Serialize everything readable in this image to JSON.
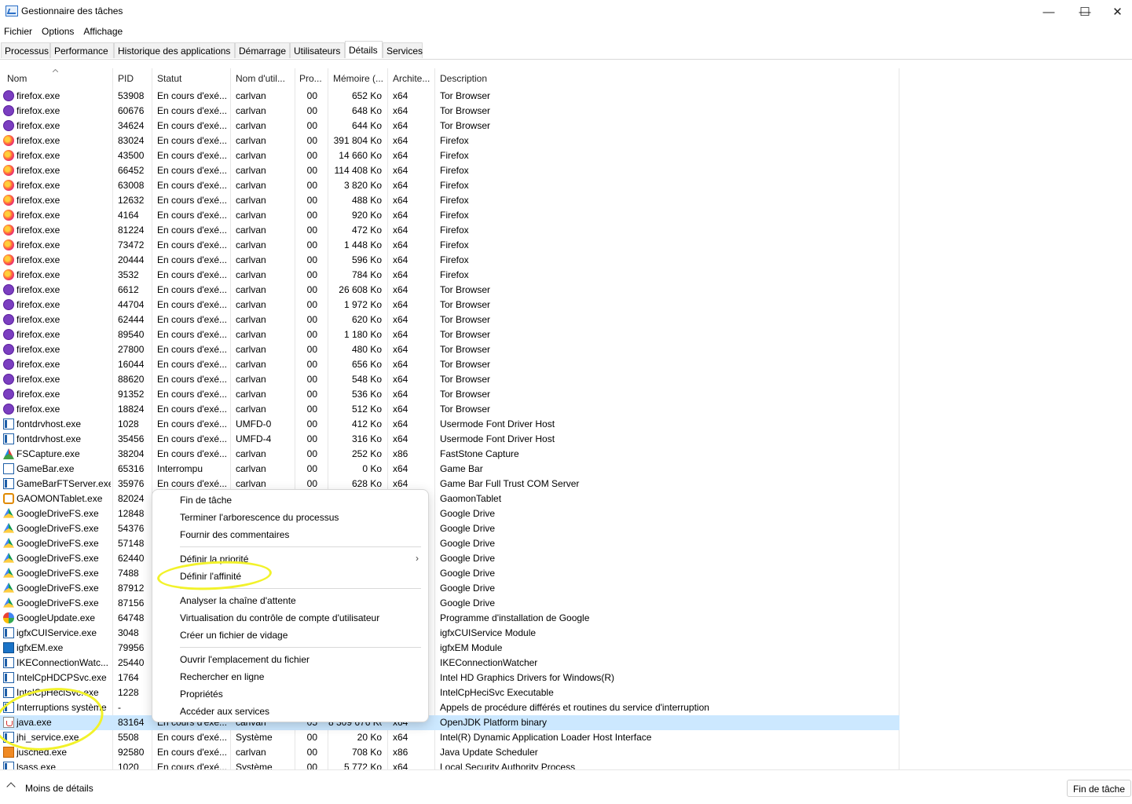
{
  "window": {
    "title": "Gestionnaire des tâches",
    "controls": [
      "—",
      "☐",
      "✕"
    ]
  },
  "menu": [
    "Fichier",
    "Options",
    "Affichage"
  ],
  "tabs": [
    "Processus",
    "Performance",
    "Historique des applications",
    "Démarrage",
    "Utilisateurs",
    "Détails",
    "Services"
  ],
  "active_tab": "Détails",
  "columns": [
    "Nom",
    "PID",
    "Statut",
    "Nom d'util...",
    "Pro...",
    "Mémoire (...",
    "Archite...",
    "Description"
  ],
  "rows": [
    {
      "icon": "tor-browser-icon",
      "name": "firefox.exe",
      "pid": "53908",
      "status": "En cours d'exé...",
      "user": "carlvan",
      "cpu": "00",
      "mem": "652 Ko",
      "arch": "x64",
      "desc": "Tor Browser"
    },
    {
      "icon": "tor-browser-icon",
      "name": "firefox.exe",
      "pid": "60676",
      "status": "En cours d'exé...",
      "user": "carlvan",
      "cpu": "00",
      "mem": "648 Ko",
      "arch": "x64",
      "desc": "Tor Browser"
    },
    {
      "icon": "tor-browser-icon",
      "name": "firefox.exe",
      "pid": "34624",
      "status": "En cours d'exé...",
      "user": "carlvan",
      "cpu": "00",
      "mem": "644 Ko",
      "arch": "x64",
      "desc": "Tor Browser"
    },
    {
      "icon": "firefox-icon",
      "name": "firefox.exe",
      "pid": "83024",
      "status": "En cours d'exé...",
      "user": "carlvan",
      "cpu": "00",
      "mem": "391 804 Ko",
      "arch": "x64",
      "desc": "Firefox"
    },
    {
      "icon": "firefox-icon",
      "name": "firefox.exe",
      "pid": "43500",
      "status": "En cours d'exé...",
      "user": "carlvan",
      "cpu": "00",
      "mem": "14 660 Ko",
      "arch": "x64",
      "desc": "Firefox"
    },
    {
      "icon": "firefox-icon",
      "name": "firefox.exe",
      "pid": "66452",
      "status": "En cours d'exé...",
      "user": "carlvan",
      "cpu": "00",
      "mem": "114 408 Ko",
      "arch": "x64",
      "desc": "Firefox"
    },
    {
      "icon": "firefox-icon",
      "name": "firefox.exe",
      "pid": "63008",
      "status": "En cours d'exé...",
      "user": "carlvan",
      "cpu": "00",
      "mem": "3 820 Ko",
      "arch": "x64",
      "desc": "Firefox"
    },
    {
      "icon": "firefox-icon",
      "name": "firefox.exe",
      "pid": "12632",
      "status": "En cours d'exé...",
      "user": "carlvan",
      "cpu": "00",
      "mem": "488 Ko",
      "arch": "x64",
      "desc": "Firefox"
    },
    {
      "icon": "firefox-icon",
      "name": "firefox.exe",
      "pid": "4164",
      "status": "En cours d'exé...",
      "user": "carlvan",
      "cpu": "00",
      "mem": "920 Ko",
      "arch": "x64",
      "desc": "Firefox"
    },
    {
      "icon": "firefox-icon",
      "name": "firefox.exe",
      "pid": "81224",
      "status": "En cours d'exé...",
      "user": "carlvan",
      "cpu": "00",
      "mem": "472 Ko",
      "arch": "x64",
      "desc": "Firefox"
    },
    {
      "icon": "firefox-icon",
      "name": "firefox.exe",
      "pid": "73472",
      "status": "En cours d'exé...",
      "user": "carlvan",
      "cpu": "00",
      "mem": "1 448 Ko",
      "arch": "x64",
      "desc": "Firefox"
    },
    {
      "icon": "firefox-icon",
      "name": "firefox.exe",
      "pid": "20444",
      "status": "En cours d'exé...",
      "user": "carlvan",
      "cpu": "00",
      "mem": "596 Ko",
      "arch": "x64",
      "desc": "Firefox"
    },
    {
      "icon": "firefox-icon",
      "name": "firefox.exe",
      "pid": "3532",
      "status": "En cours d'exé...",
      "user": "carlvan",
      "cpu": "00",
      "mem": "784 Ko",
      "arch": "x64",
      "desc": "Firefox"
    },
    {
      "icon": "tor-browser-icon",
      "name": "firefox.exe",
      "pid": "6612",
      "status": "En cours d'exé...",
      "user": "carlvan",
      "cpu": "00",
      "mem": "26 608 Ko",
      "arch": "x64",
      "desc": "Tor Browser"
    },
    {
      "icon": "tor-browser-icon",
      "name": "firefox.exe",
      "pid": "44704",
      "status": "En cours d'exé...",
      "user": "carlvan",
      "cpu": "00",
      "mem": "1 972 Ko",
      "arch": "x64",
      "desc": "Tor Browser"
    },
    {
      "icon": "tor-browser-icon",
      "name": "firefox.exe",
      "pid": "62444",
      "status": "En cours d'exé...",
      "user": "carlvan",
      "cpu": "00",
      "mem": "620 Ko",
      "arch": "x64",
      "desc": "Tor Browser"
    },
    {
      "icon": "tor-browser-icon",
      "name": "firefox.exe",
      "pid": "89540",
      "status": "En cours d'exé...",
      "user": "carlvan",
      "cpu": "00",
      "mem": "1 180 Ko",
      "arch": "x64",
      "desc": "Tor Browser"
    },
    {
      "icon": "tor-browser-icon",
      "name": "firefox.exe",
      "pid": "27800",
      "status": "En cours d'exé...",
      "user": "carlvan",
      "cpu": "00",
      "mem": "480 Ko",
      "arch": "x64",
      "desc": "Tor Browser"
    },
    {
      "icon": "tor-browser-icon",
      "name": "firefox.exe",
      "pid": "16044",
      "status": "En cours d'exé...",
      "user": "carlvan",
      "cpu": "00",
      "mem": "656 Ko",
      "arch": "x64",
      "desc": "Tor Browser"
    },
    {
      "icon": "tor-browser-icon",
      "name": "firefox.exe",
      "pid": "88620",
      "status": "En cours d'exé...",
      "user": "carlvan",
      "cpu": "00",
      "mem": "548 Ko",
      "arch": "x64",
      "desc": "Tor Browser"
    },
    {
      "icon": "tor-browser-icon",
      "name": "firefox.exe",
      "pid": "91352",
      "status": "En cours d'exé...",
      "user": "carlvan",
      "cpu": "00",
      "mem": "536 Ko",
      "arch": "x64",
      "desc": "Tor Browser"
    },
    {
      "icon": "tor-browser-icon",
      "name": "firefox.exe",
      "pid": "18824",
      "status": "En cours d'exé...",
      "user": "carlvan",
      "cpu": "00",
      "mem": "512 Ko",
      "arch": "x64",
      "desc": "Tor Browser"
    },
    {
      "icon": "window-app-icon",
      "name": "fontdrvhost.exe",
      "pid": "1028",
      "status": "En cours d'exé...",
      "user": "UMFD-0",
      "cpu": "00",
      "mem": "412 Ko",
      "arch": "x64",
      "desc": "Usermode Font Driver Host"
    },
    {
      "icon": "window-app-icon",
      "name": "fontdrvhost.exe",
      "pid": "35456",
      "status": "En cours d'exé...",
      "user": "UMFD-4",
      "cpu": "00",
      "mem": "316 Ko",
      "arch": "x64",
      "desc": "Usermode Font Driver Host"
    },
    {
      "icon": "fscapture-icon",
      "name": "FSCapture.exe",
      "pid": "38204",
      "status": "En cours d'exé...",
      "user": "carlvan",
      "cpu": "00",
      "mem": "252 Ko",
      "arch": "x86",
      "desc": "FastStone Capture"
    },
    {
      "icon": "gamebar-icon",
      "name": "GameBar.exe",
      "pid": "65316",
      "status": "Interrompu",
      "user": "carlvan",
      "cpu": "00",
      "mem": "0 Ko",
      "arch": "x64",
      "desc": "Game Bar"
    },
    {
      "icon": "window-app-icon",
      "name": "GameBarFTServer.exe",
      "pid": "35976",
      "status": "En cours d'exé...",
      "user": "carlvan",
      "cpu": "00",
      "mem": "628 Ko",
      "arch": "x64",
      "desc": "Game Bar Full Trust COM Server"
    },
    {
      "icon": "gaomon-icon",
      "name": "GAOMONTablet.exe",
      "pid": "82024",
      "status": "",
      "user": "",
      "cpu": "",
      "mem": "",
      "arch": "",
      "desc": "GaomonTablet"
    },
    {
      "icon": "google-drive-icon",
      "name": "GoogleDriveFS.exe",
      "pid": "12848",
      "status": "",
      "user": "",
      "cpu": "",
      "mem": "",
      "arch": "",
      "desc": "Google Drive"
    },
    {
      "icon": "google-drive-icon",
      "name": "GoogleDriveFS.exe",
      "pid": "54376",
      "status": "",
      "user": "",
      "cpu": "",
      "mem": "",
      "arch": "",
      "desc": "Google Drive"
    },
    {
      "icon": "google-drive-icon",
      "name": "GoogleDriveFS.exe",
      "pid": "57148",
      "status": "",
      "user": "",
      "cpu": "",
      "mem": "",
      "arch": "",
      "desc": "Google Drive"
    },
    {
      "icon": "google-drive-icon",
      "name": "GoogleDriveFS.exe",
      "pid": "62440",
      "status": "",
      "user": "",
      "cpu": "",
      "mem": "",
      "arch": "",
      "desc": "Google Drive"
    },
    {
      "icon": "google-drive-icon",
      "name": "GoogleDriveFS.exe",
      "pid": "7488",
      "status": "",
      "user": "",
      "cpu": "",
      "mem": "",
      "arch": "",
      "desc": "Google Drive"
    },
    {
      "icon": "google-drive-icon",
      "name": "GoogleDriveFS.exe",
      "pid": "87912",
      "status": "",
      "user": "",
      "cpu": "",
      "mem": "",
      "arch": "",
      "desc": "Google Drive"
    },
    {
      "icon": "google-drive-icon",
      "name": "GoogleDriveFS.exe",
      "pid": "87156",
      "status": "",
      "user": "",
      "cpu": "",
      "mem": "",
      "arch": "",
      "desc": "Google Drive"
    },
    {
      "icon": "google-update-icon",
      "name": "GoogleUpdate.exe",
      "pid": "64748",
      "status": "",
      "user": "",
      "cpu": "",
      "mem": "",
      "arch": "",
      "desc": "Programme d'installation de Google"
    },
    {
      "icon": "window-app-icon",
      "name": "igfxCUIService.exe",
      "pid": "3048",
      "status": "",
      "user": "",
      "cpu": "",
      "mem": "",
      "arch": "",
      "desc": "igfxCUIService Module"
    },
    {
      "icon": "intel-graphics-icon",
      "name": "igfxEM.exe",
      "pid": "79956",
      "status": "",
      "user": "",
      "cpu": "",
      "mem": "",
      "arch": "",
      "desc": "igfxEM Module"
    },
    {
      "icon": "window-app-icon",
      "name": "IKEConnectionWatc...",
      "pid": "25440",
      "status": "",
      "user": "",
      "cpu": "",
      "mem": "",
      "arch": "",
      "desc": "IKEConnectionWatcher"
    },
    {
      "icon": "window-app-icon",
      "name": "IntelCpHDCPSvc.exe",
      "pid": "1764",
      "status": "",
      "user": "",
      "cpu": "",
      "mem": "",
      "arch": "",
      "desc": "Intel HD Graphics Drivers for Windows(R)"
    },
    {
      "icon": "window-app-icon",
      "name": "IntelCpHeciSvc.exe",
      "pid": "1228",
      "status": "",
      "user": "",
      "cpu": "",
      "mem": "",
      "arch": "",
      "desc": "IntelCpHeciSvc Executable"
    },
    {
      "icon": "window-app-icon",
      "name": "Interruptions système",
      "pid": "-",
      "status": "",
      "user": "",
      "cpu": "",
      "mem": "",
      "arch": "",
      "desc": "Appels de procédure différés et routines du service d'interruption"
    },
    {
      "icon": "java-icon",
      "name": "java.exe",
      "pid": "83164",
      "status": "En cours d'exé...",
      "user": "carlvan",
      "cpu": "05",
      "mem": "8 309 676 Ko",
      "arch": "x64",
      "desc": "OpenJDK Platform binary",
      "selected": true
    },
    {
      "icon": "window-app-icon",
      "name": "jhi_service.exe",
      "pid": "5508",
      "status": "En cours d'exé...",
      "user": "Système",
      "cpu": "00",
      "mem": "20 Ko",
      "arch": "x64",
      "desc": "Intel(R) Dynamic Application Loader Host Interface"
    },
    {
      "icon": "jusched-icon",
      "name": "jusched.exe",
      "pid": "92580",
      "status": "En cours d'exé...",
      "user": "carlvan",
      "cpu": "00",
      "mem": "708 Ko",
      "arch": "x86",
      "desc": "Java Update Scheduler"
    },
    {
      "icon": "window-app-icon",
      "name": "lsass.exe",
      "pid": "1020",
      "status": "En cours d'exé...",
      "user": "Système",
      "cpu": "00",
      "mem": "5 772 Ko",
      "arch": "x64",
      "desc": "Local Security Authority Process"
    }
  ],
  "context_menu": {
    "items": [
      "Fin de tâche",
      "Terminer l'arborescence du processus",
      "Fournir des commentaires",
      "Définir la priorité",
      "Définir l'affinité",
      "Analyser la chaîne d'attente",
      "Virtualisation du contrôle de compte d'utilisateur",
      "Créer un fichier de vidage",
      "Ouvrir l'emplacement du fichier",
      "Rechercher en ligne",
      "Propriétés",
      "Accéder aux services"
    ],
    "submenu_arrow": "›"
  },
  "footer": {
    "less_details": "Moins de détails",
    "end_task": "Fin de tâche"
  },
  "colors": {
    "selection": "#cce8ff",
    "annotation": "#f2f22a"
  }
}
